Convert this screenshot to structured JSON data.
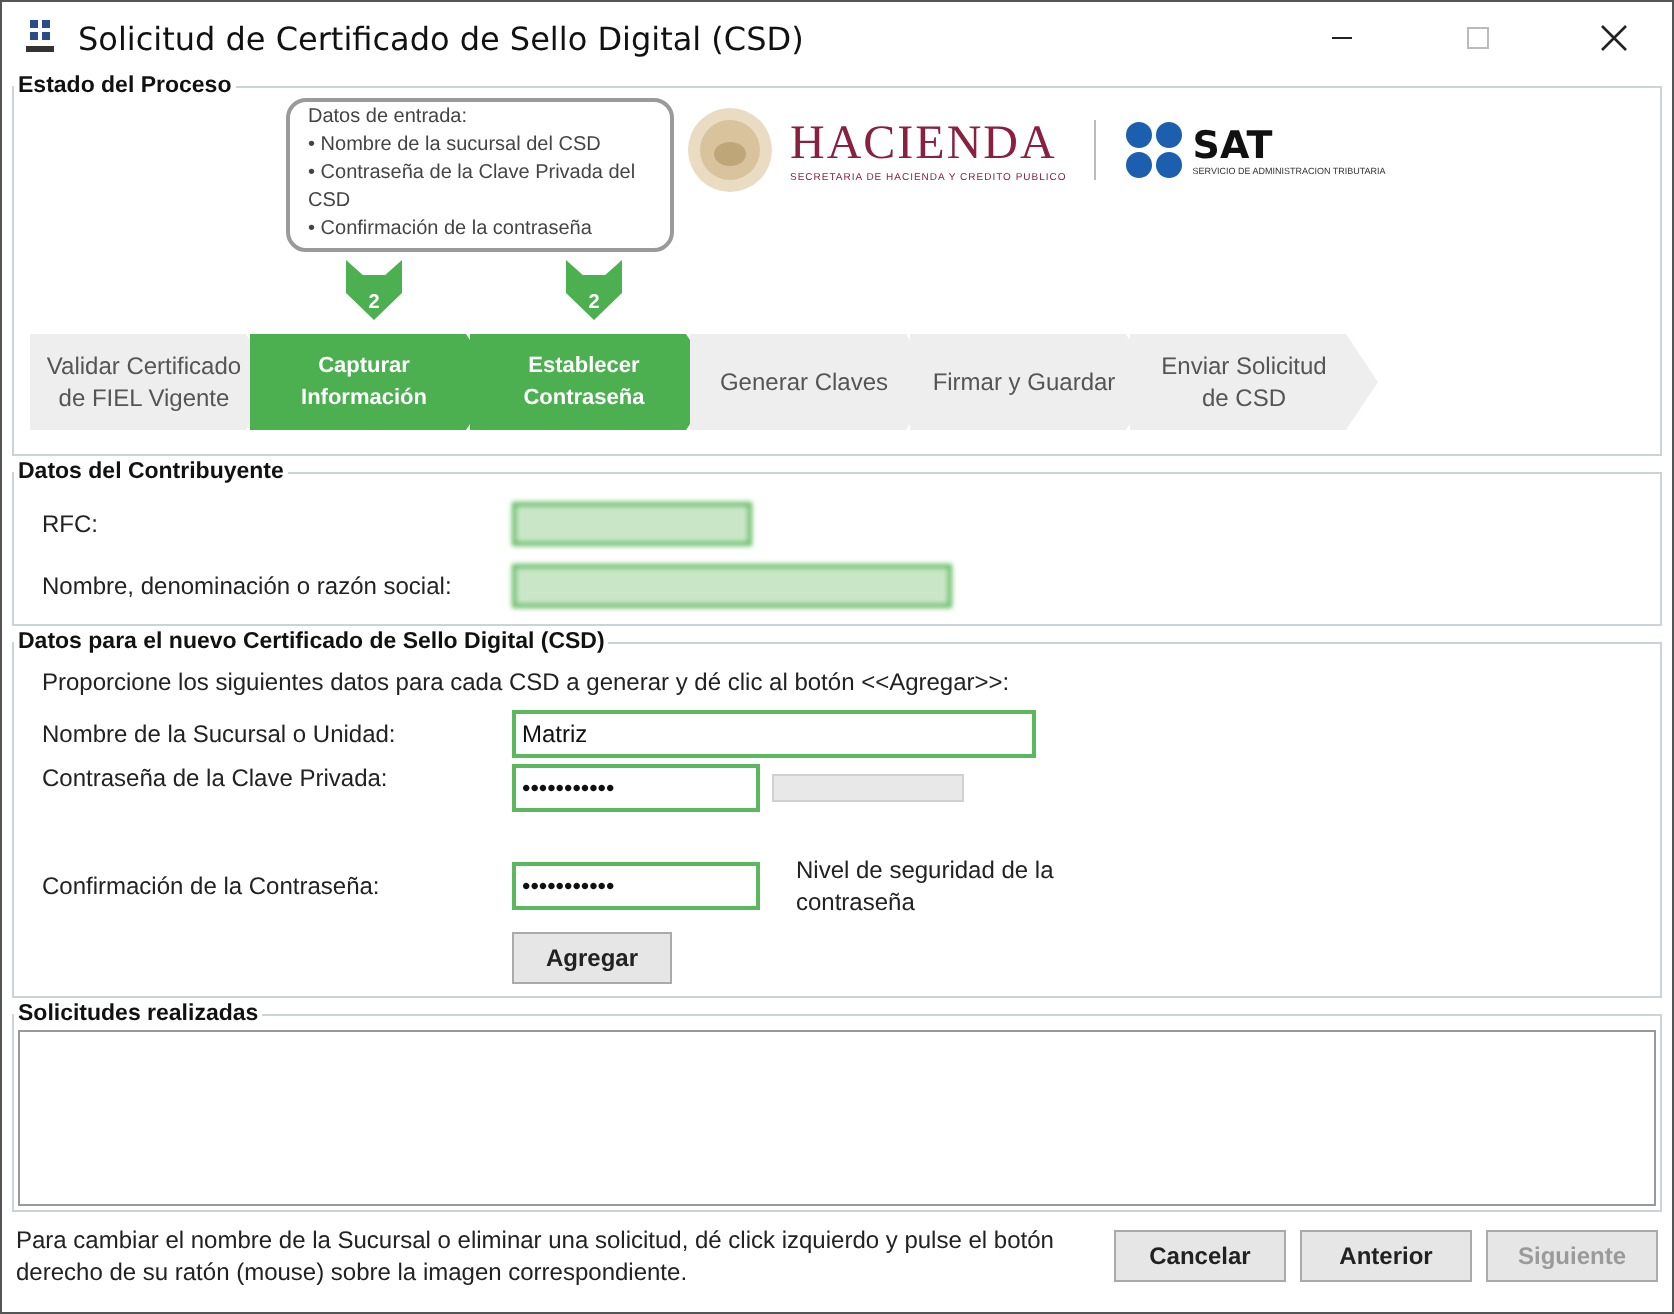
{
  "window": {
    "title": "Solicitud de Certificado de Sello Digital (CSD)"
  },
  "process": {
    "legend": "Estado del Proceso",
    "bubble": {
      "title": "Datos de entrada:",
      "items": [
        "• Nombre de la sucursal del CSD",
        "• Contraseña de la Clave Privada del CSD",
        "• Confirmación de la contraseña"
      ]
    },
    "logo": {
      "name": "HACIENDA",
      "subtitle": "SECRETARIA DE HACIENDA Y CREDITO PUBLICO",
      "sat": "SAT",
      "sat_subtitle": "SERVICIO DE ADMINISTRACION TRIBUTARIA"
    },
    "steps": [
      {
        "label": "Validar Certificado de FIEL Vigente",
        "active": false
      },
      {
        "label": "Capturar Información",
        "active": true,
        "marker": "2"
      },
      {
        "label": "Establecer Contraseña",
        "active": true,
        "marker": "2"
      },
      {
        "label": "Generar Claves",
        "active": false
      },
      {
        "label": "Firmar y Guardar",
        "active": false
      },
      {
        "label": "Enviar Solicitud de CSD",
        "active": false
      }
    ]
  },
  "taxpayer": {
    "legend": "Datos del Contribuyente",
    "fields": [
      {
        "label": "RFC:",
        "blurred": true
      },
      {
        "label": "Nombre, denominación o razón social:",
        "blurred": true
      }
    ]
  },
  "certificate": {
    "legend": "Datos para el nuevo Certificado de Sello Digital (CSD)",
    "instructions": "Proporcione los siguientes datos para cada CSD a generar y dé clic al botón <<Agregar>>:",
    "branch": {
      "label": "Nombre de la Sucursal o Unidad:",
      "value": "Matriz"
    },
    "password": {
      "label": "Contraseña de la Clave Privada:",
      "value": "•••••••••••"
    },
    "strength": {
      "level": 0,
      "label": "Nivel de seguridad de la contraseña"
    },
    "confirm": {
      "label": "Confirmación de la Contraseña:",
      "value": "•••••••••••"
    },
    "add_button": "Agregar"
  },
  "requests": {
    "legend": "Solicitudes realizadas"
  },
  "footer": {
    "note": "Para cambiar el nombre de la Sucursal o eliminar una solicitud, dé click izquierdo y pulse el botón derecho de su ratón (mouse) sobre la imagen correspondiente.",
    "buttons": [
      {
        "label": "Cancelar",
        "disabled": false
      },
      {
        "label": "Anterior",
        "disabled": false
      },
      {
        "label": "Siguiente",
        "disabled": true
      }
    ]
  }
}
